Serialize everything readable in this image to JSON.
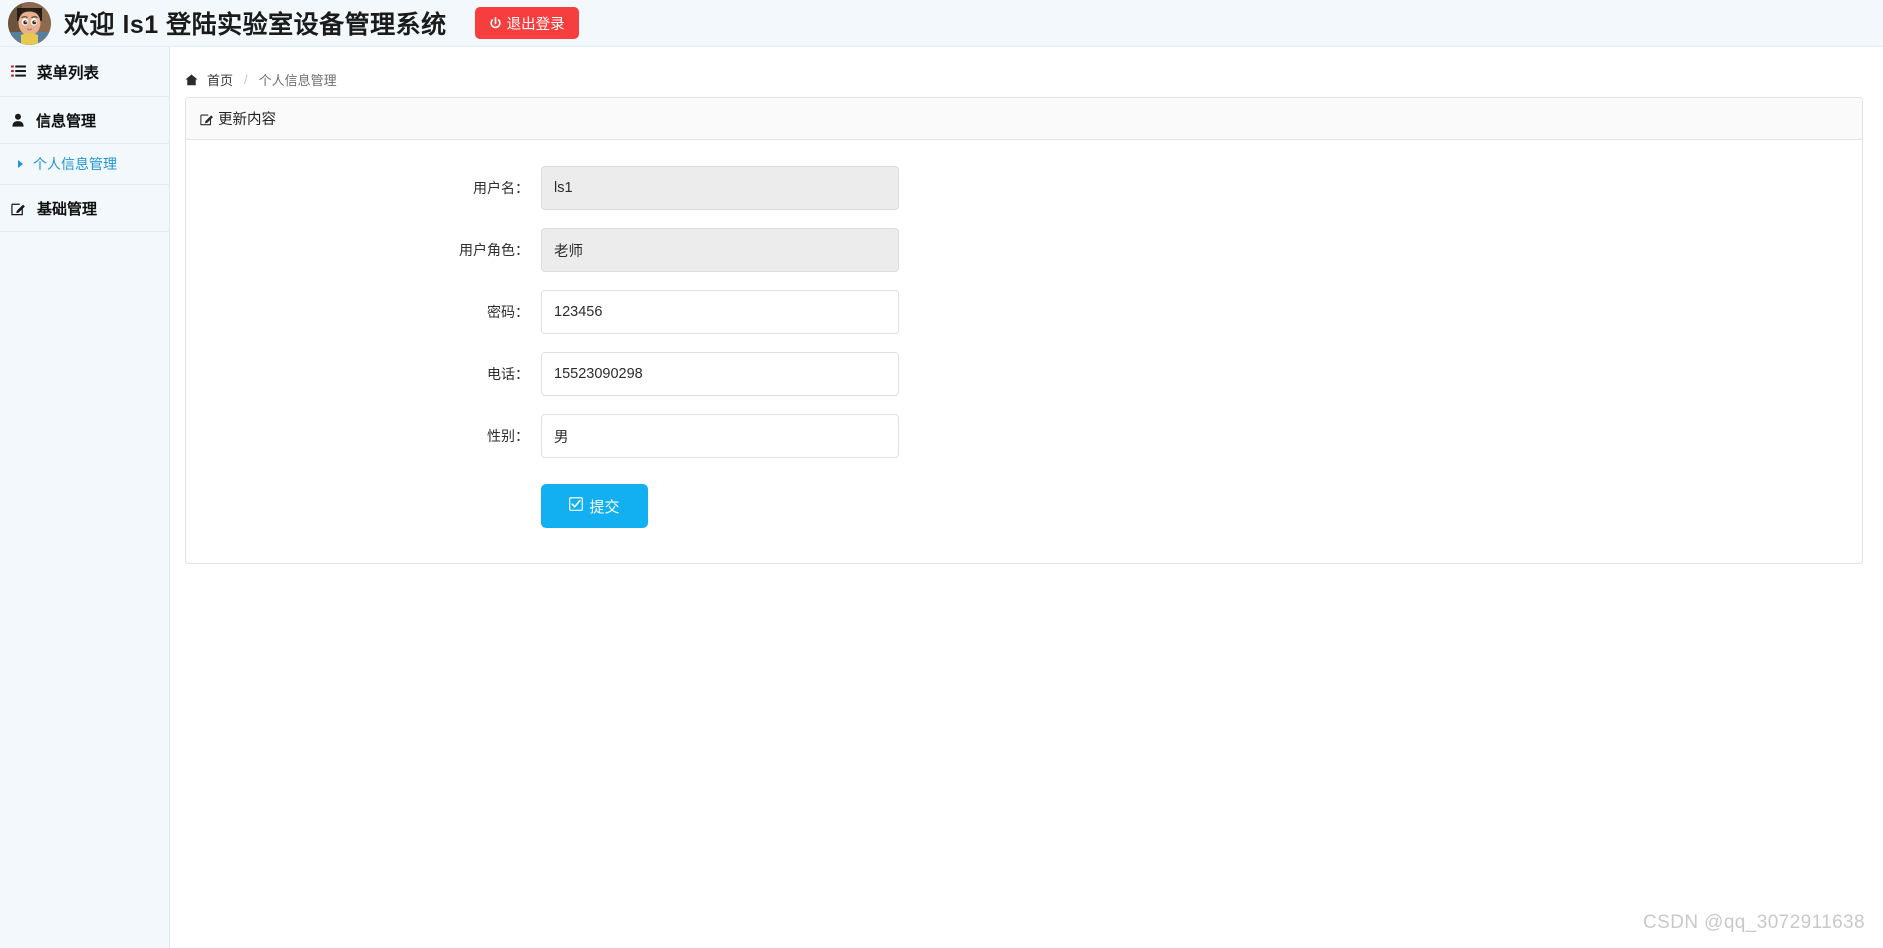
{
  "header": {
    "avatar_alt": "用户头像",
    "title": "欢迎 ls1 登陆实验室设备管理系统",
    "logout_label": "退出登录",
    "logout_color": "#f73e3e"
  },
  "sidebar": {
    "menu_head": "菜单列表",
    "groups": [
      {
        "label": "信息管理",
        "icon": "user-icon"
      }
    ],
    "sub_items": [
      {
        "label": "个人信息管理",
        "active": true
      }
    ],
    "groups2": [
      {
        "label": "基础管理",
        "icon": "edit-square-icon"
      }
    ],
    "accent_color": "#2196d6",
    "background": "#f2f8fb"
  },
  "breadcrumb": {
    "home": "首页",
    "separator": "/",
    "current": "个人信息管理"
  },
  "panel": {
    "heading": "更新内容",
    "fields": [
      {
        "label": "用户名：",
        "value": "ls1",
        "disabled": true,
        "name": "username"
      },
      {
        "label": "用户角色：",
        "value": "老师",
        "disabled": true,
        "name": "user-role"
      },
      {
        "label": "密码：",
        "value": "123456",
        "disabled": false,
        "name": "password"
      },
      {
        "label": "电话：",
        "value": "15523090298",
        "disabled": false,
        "name": "phone"
      },
      {
        "label": "性别：",
        "value": "男",
        "disabled": false,
        "name": "gender"
      }
    ],
    "submit_label": "提交",
    "submit_color": "#12b0f0"
  },
  "watermark": "CSDN @qq_3072911638"
}
